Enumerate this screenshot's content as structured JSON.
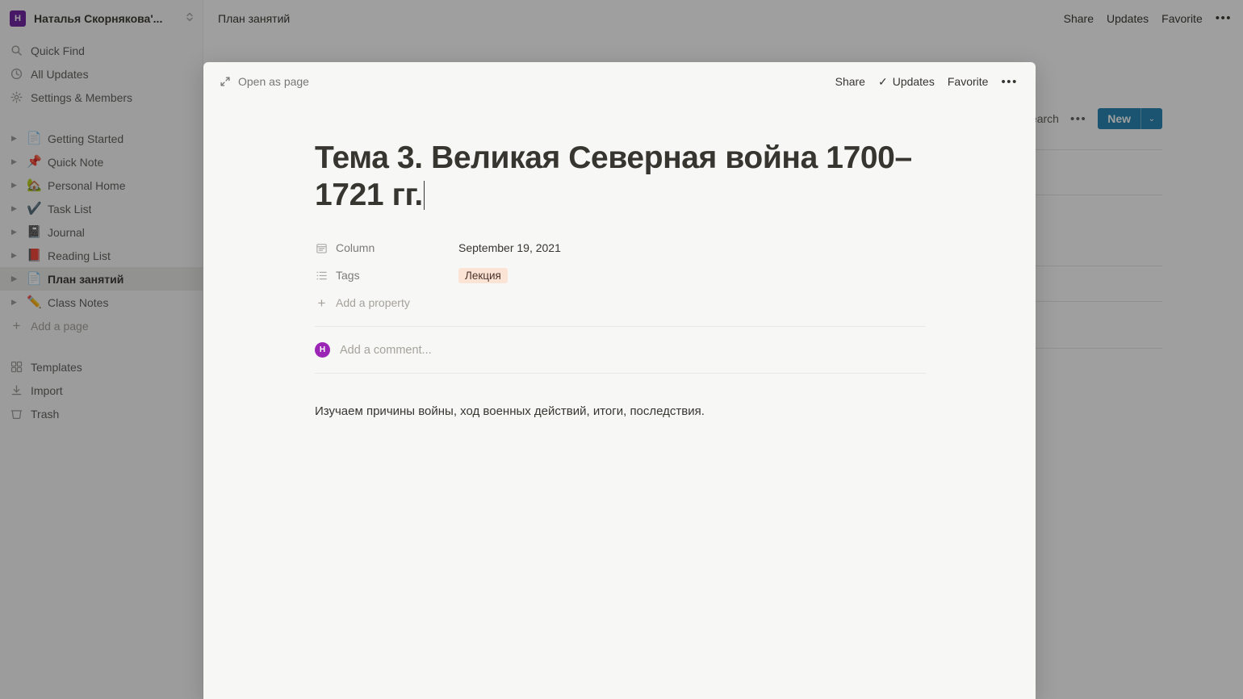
{
  "sidebar": {
    "workspace": {
      "avatar_letter": "H",
      "name": "Наталья Скорнякова'..."
    },
    "nav": [
      {
        "label": "Quick Find",
        "icon": "search-icon"
      },
      {
        "label": "All Updates",
        "icon": "clock-icon"
      },
      {
        "label": "Settings & Members",
        "icon": "gear-icon"
      }
    ],
    "pages": [
      {
        "label": "Getting Started",
        "emoji": "📄",
        "selected": false
      },
      {
        "label": "Quick Note",
        "emoji": "📌",
        "selected": false
      },
      {
        "label": "Personal Home",
        "emoji": "🏡",
        "selected": false
      },
      {
        "label": "Task List",
        "emoji": "✔️",
        "selected": false
      },
      {
        "label": "Journal",
        "emoji": "📓",
        "selected": false
      },
      {
        "label": "Reading List",
        "emoji": "📕",
        "selected": false
      },
      {
        "label": "План занятий",
        "emoji": "📄",
        "selected": true
      },
      {
        "label": "Class Notes",
        "emoji": "✏️",
        "selected": false
      }
    ],
    "add_page_label": "Add a page",
    "footer": [
      {
        "label": "Templates",
        "icon": "templates-icon"
      },
      {
        "label": "Import",
        "icon": "import-icon"
      },
      {
        "label": "Trash",
        "icon": "trash-icon"
      }
    ]
  },
  "topbar": {
    "breadcrumb": "План занятий",
    "share_label": "Share",
    "updates_label": "Updates",
    "favorite_label": "Favorite",
    "more_label": "•••"
  },
  "board": {
    "search_label": "Search",
    "more_label": "•••",
    "new_label": "New",
    "new_chevron": "⌄",
    "row_count": 5
  },
  "modal": {
    "open_as_page_label": "Open as page",
    "share_label": "Share",
    "updates_label": "Updates",
    "updates_check": "✓",
    "favorite_label": "Favorite",
    "more_label": "•••",
    "title": "Тема 3. Великая Северная война 1700–1721 гг.",
    "properties": [
      {
        "name": "Column",
        "icon": "calendar-icon",
        "value": "September 19, 2021",
        "type": "date"
      },
      {
        "name": "Tags",
        "icon": "list-icon",
        "value": "Лекция",
        "type": "tag"
      }
    ],
    "add_property_label": "Add a property",
    "comment": {
      "avatar_letter": "H",
      "placeholder": "Add a comment..."
    },
    "body_text": "Изучаем причины войны, ход военных действий, итоги, последствия."
  },
  "colors": {
    "accent_blue": "#2383b2",
    "avatar_purple": "#9b26b6",
    "workspace_purple": "#6b1fa0",
    "tag_bg": "#fbe4d5",
    "modal_bg": "#f7f7f5",
    "sidebar_bg": "#fbfbfa"
  }
}
